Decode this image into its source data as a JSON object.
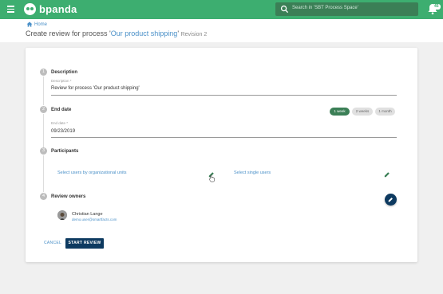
{
  "app": {
    "brand": "bpanda",
    "search_placeholder": "Search in 'SBT Process Space'",
    "notification_count": "45"
  },
  "breadcrumb": {
    "home": "Home"
  },
  "title": {
    "prefix": "Create review for process '",
    "process_name": "Our product shipping",
    "suffix": "'",
    "revision": "Revision 2"
  },
  "steps": [
    {
      "number": "1",
      "title": "Description"
    },
    {
      "number": "2",
      "title": "End date"
    },
    {
      "number": "3",
      "title": "Participants"
    },
    {
      "number": "4",
      "title": "Review owners"
    }
  ],
  "description": {
    "label": "Description *",
    "value": "Review for process 'Our product shipping'"
  },
  "end_date": {
    "label": "End date *",
    "value": "09/23/2019",
    "durations": [
      "1 week",
      "2 weeks",
      "1 month"
    ],
    "selected": "1 week"
  },
  "participants": {
    "by_org_units": "Select users by organizational units",
    "single_users": "Select single users"
  },
  "owner": {
    "name": "Christian Lange",
    "email": "demo.user@smartfacts.com"
  },
  "actions": {
    "cancel": "CANCEL",
    "start": "START REVIEW"
  },
  "colors": {
    "topbar": "#3dae70",
    "primary": "#0d3a60",
    "link": "#4a90c8"
  }
}
